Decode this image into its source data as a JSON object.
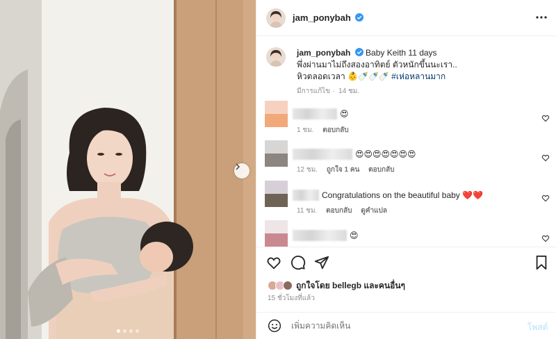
{
  "post": {
    "username": "jam_ponybah",
    "caption": {
      "line1": "Baby Keith 11 days",
      "line2": "พึ่งผ่านมาไม่ถึงสองอาทิตย์ ตัวหนักขึ้นนะเรา..",
      "line3_text": "หิวตลอดเวลา 👶🍼🍼🍼",
      "hashtag": "#เห่อหลานมาก",
      "edited": "มีการแก้ไข",
      "age": "14 ชม."
    }
  },
  "comments": [
    {
      "emojis": "😍",
      "time": "1 ชม.",
      "reply": "ตอบกลับ",
      "likes": "",
      "translate": ""
    },
    {
      "emojis": "😍😍😍😍😍😍😍",
      "time": "12 ชม.",
      "likes": "ถูกใจ 1 คน",
      "reply": "ตอบกลับ",
      "translate": ""
    },
    {
      "text": "Congratulations on the beautiful baby",
      "emojis": "❤️❤️",
      "time": "11 ชม.",
      "reply": "ตอบกลับ",
      "translate": "ดูคำแปล",
      "likes": ""
    },
    {
      "emojis": "😍",
      "time": "",
      "reply": "",
      "likes": "",
      "translate": ""
    }
  ],
  "likes": {
    "text": "ถูกใจโดย bellegb และคนอื่นๆ",
    "time": "15 ชั่วโมงที่แล้ว"
  },
  "composer": {
    "placeholder": "เพิ่มความคิดเห็น",
    "post_label": "โพสต์"
  },
  "icons": {
    "more": "more-options-icon",
    "heart": "heart-icon",
    "comment": "comment-icon",
    "share": "share-icon",
    "save": "bookmark-icon",
    "emoji": "emoji-icon",
    "next": "chevron-right-icon"
  },
  "colors": {
    "verified": "#3897f0",
    "hashtag": "#00376b",
    "muted": "#8e8e8e",
    "post_disabled": "#b2dffc",
    "heart_red": "#ed4956"
  },
  "carousel": {
    "count": 4,
    "active_index": 0
  }
}
